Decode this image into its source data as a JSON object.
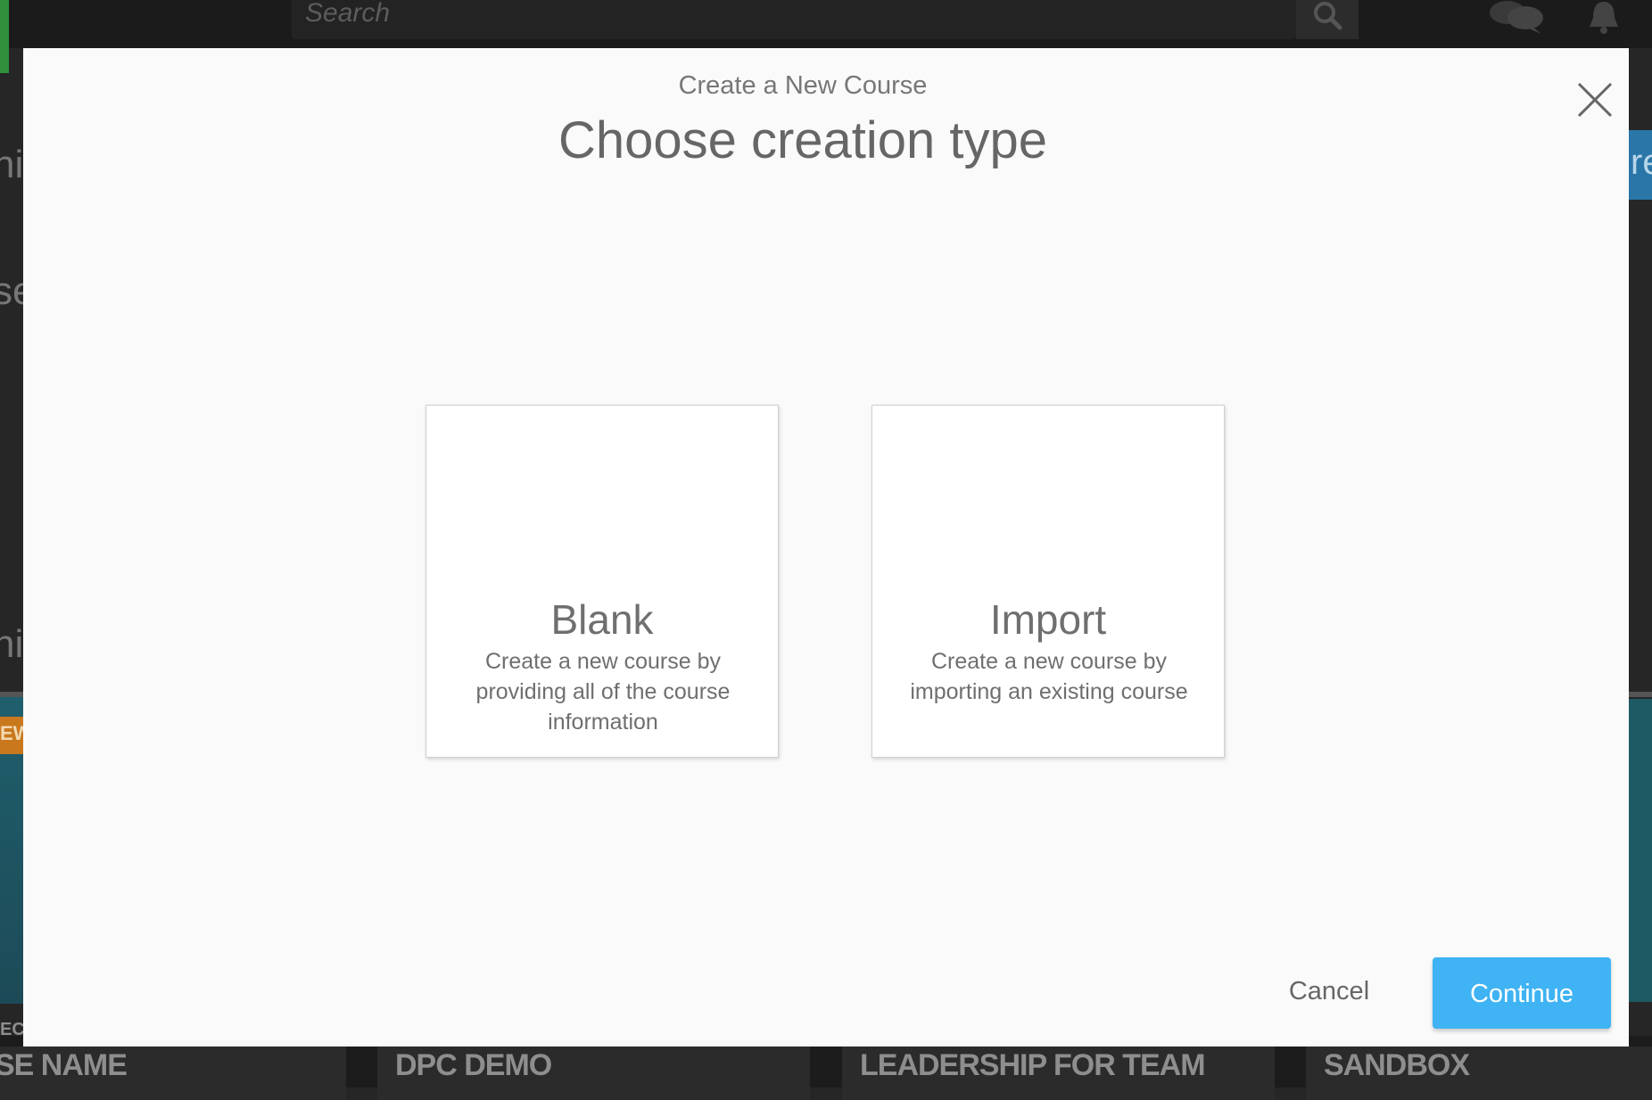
{
  "background": {
    "search_placeholder": "Search",
    "side_fragments": [
      "ni",
      "se",
      "ni"
    ],
    "right_fragment": "re",
    "left_badge": "EW",
    "left_sub_label": "EC",
    "course_cards": [
      "SE NAME",
      "DPC DEMO",
      "LEADERSHIP FOR TEAM",
      "SANDBOX"
    ]
  },
  "modal": {
    "subtitle": "Create a New Course",
    "title": "Choose creation type",
    "close_icon": "close-icon",
    "options": [
      {
        "title": "Blank",
        "description": "Create a new course by providing all of the course information"
      },
      {
        "title": "Import",
        "description": "Create a new course by importing an existing course"
      }
    ],
    "cancel_label": "Cancel",
    "continue_label": "Continue"
  },
  "colors": {
    "accent": "#3fb3f3",
    "modal_background": "#fafafa",
    "overlay_background": "#262626"
  }
}
